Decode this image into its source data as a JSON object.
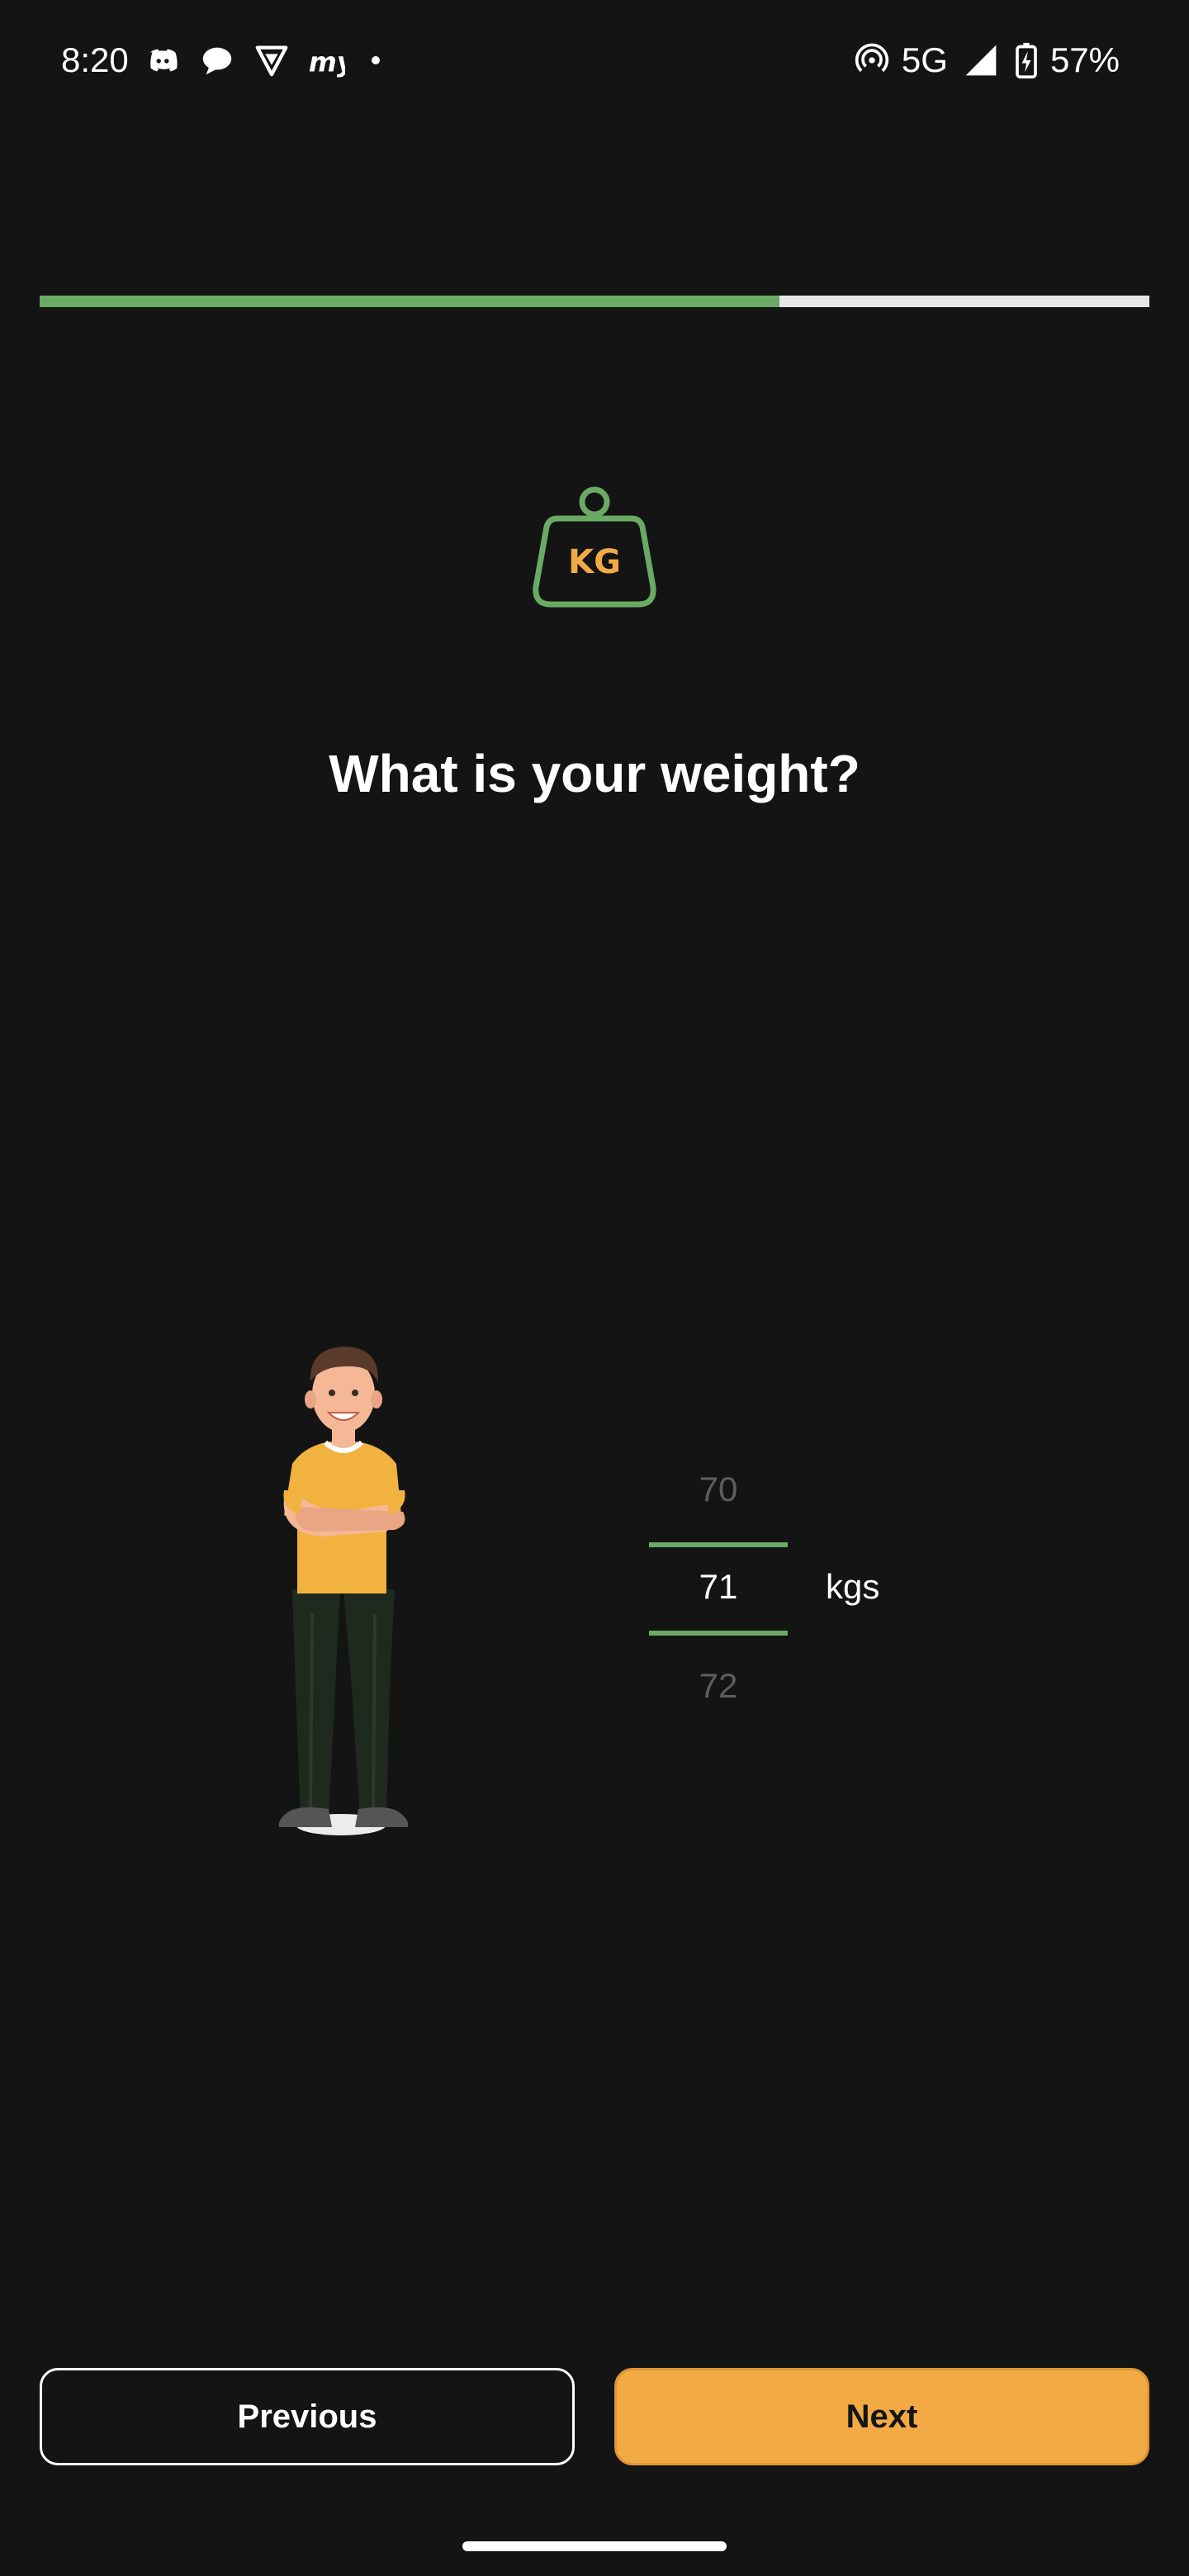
{
  "status_bar": {
    "time": "8:20",
    "notification_icons": [
      "discord-icon",
      "chat-bubble-icon",
      "vpn-shield-icon",
      "myntra-icon"
    ],
    "network": "5G",
    "battery": "57%"
  },
  "onboarding": {
    "progress_fraction": 0.667,
    "progress_fill_color": "#6aaa64",
    "icon_text": "KG",
    "question": "What is your weight?"
  },
  "weight_picker": {
    "previous_value": "70",
    "selected_value": "71",
    "next_value": "72",
    "unit": "kgs"
  },
  "buttons": {
    "previous_label": "Previous",
    "next_label": "Next",
    "next_color": "#f2aa45"
  }
}
